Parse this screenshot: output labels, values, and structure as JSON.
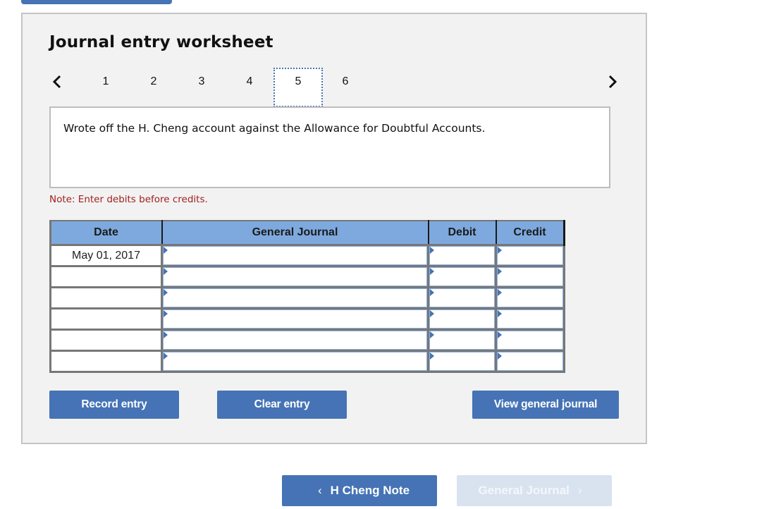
{
  "worksheet": {
    "title": "Journal entry worksheet",
    "pager": {
      "prev_icon": "chevron-left-icon",
      "next_icon": "chevron-right-icon",
      "pages": [
        "1",
        "2",
        "3",
        "4",
        "5",
        "6"
      ],
      "active_page": "5"
    },
    "description": "Wrote off the H. Cheng account against the Allowance for Doubtful Accounts.",
    "note": "Note: Enter debits before credits.",
    "table": {
      "headers": [
        "Date",
        "General Journal",
        "Debit",
        "Credit"
      ],
      "rows": [
        {
          "date": "May 01, 2017",
          "account": "",
          "debit": "",
          "credit": ""
        },
        {
          "date": "",
          "account": "",
          "debit": "",
          "credit": ""
        },
        {
          "date": "",
          "account": "",
          "debit": "",
          "credit": ""
        },
        {
          "date": "",
          "account": "",
          "debit": "",
          "credit": ""
        },
        {
          "date": "",
          "account": "",
          "debit": "",
          "credit": ""
        },
        {
          "date": "",
          "account": "",
          "debit": "",
          "credit": ""
        }
      ]
    },
    "buttons": {
      "record": "Record entry",
      "clear": "Clear entry",
      "view": "View general journal"
    }
  },
  "navigation": {
    "prev_label": "H Cheng Note",
    "prev_icon": "‹",
    "next_label": "General Journal",
    "next_icon": "›",
    "next_disabled": true
  },
  "colors": {
    "accent": "#4573b5",
    "header_bg": "#7ea9de",
    "note_text": "#a0201e",
    "panel_bg": "#f2f2f2",
    "disabled_bg": "#d9e3ef"
  }
}
